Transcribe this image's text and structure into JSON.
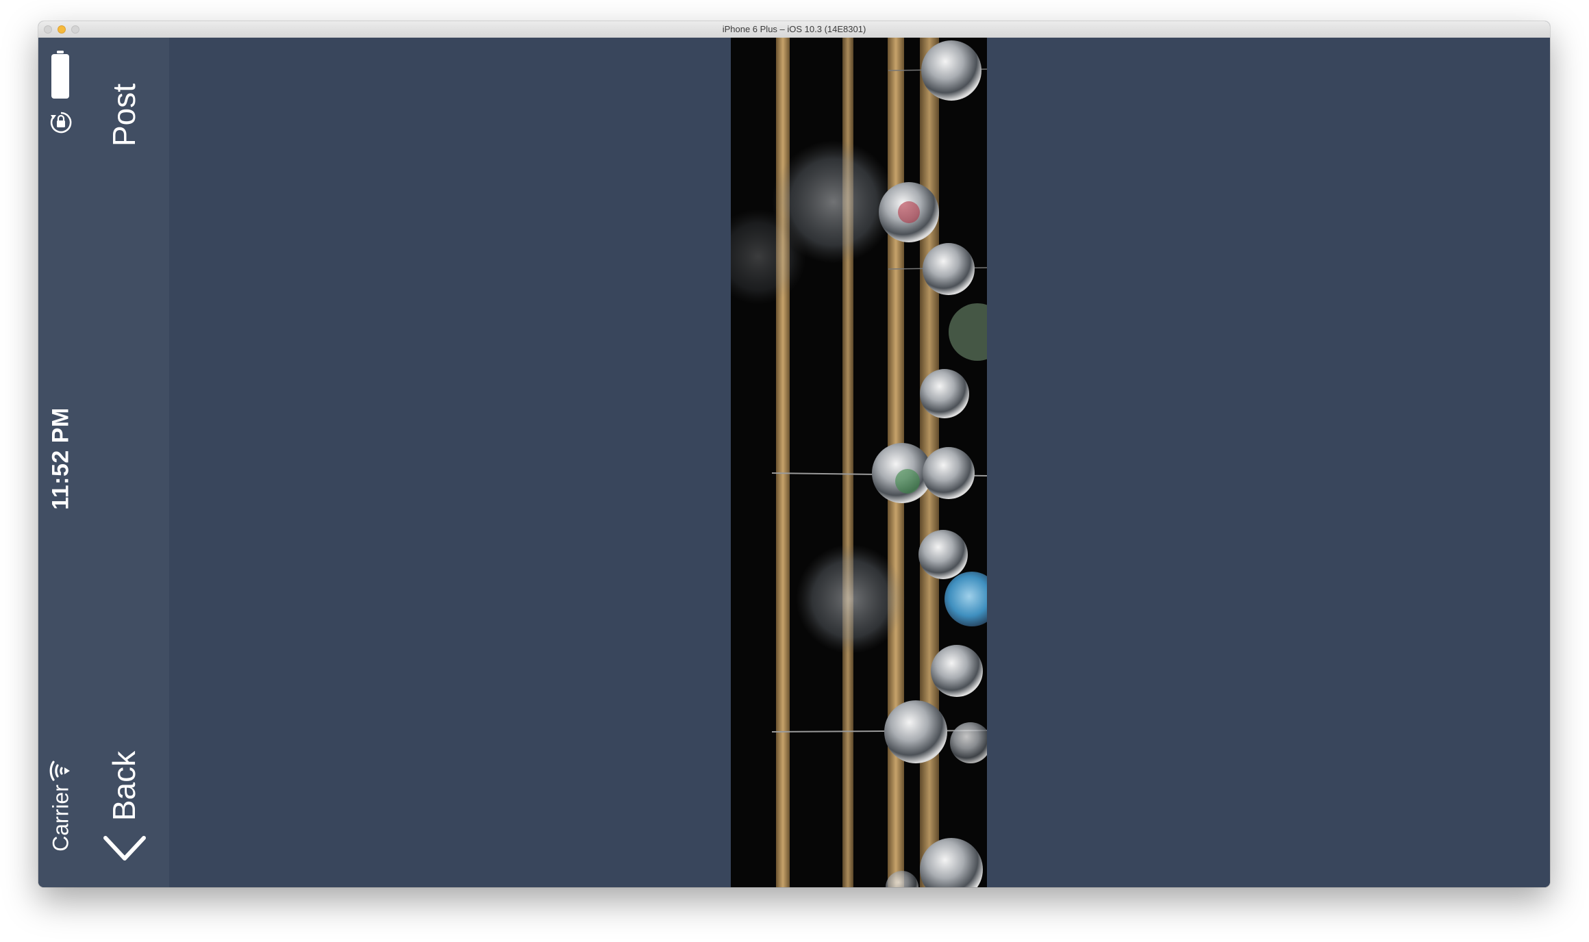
{
  "window": {
    "title": "iPhone 6 Plus – iOS 10.3 (14E8301)"
  },
  "status_bar": {
    "time": "11:52 PM",
    "carrier": "Carrier"
  },
  "nav_bar": {
    "back_label": "Back",
    "post_label": "Post"
  },
  "photo": {
    "subject": "glass wind chimes"
  },
  "colors": {
    "background": "#39465c",
    "nav_bar": "#414e63",
    "text": "#ffffff"
  },
  "icons": {
    "battery": "battery-icon",
    "orientation_lock": "rotation-lock-icon",
    "wifi": "wifi-icon",
    "back_chevron": "chevron-left-icon"
  }
}
